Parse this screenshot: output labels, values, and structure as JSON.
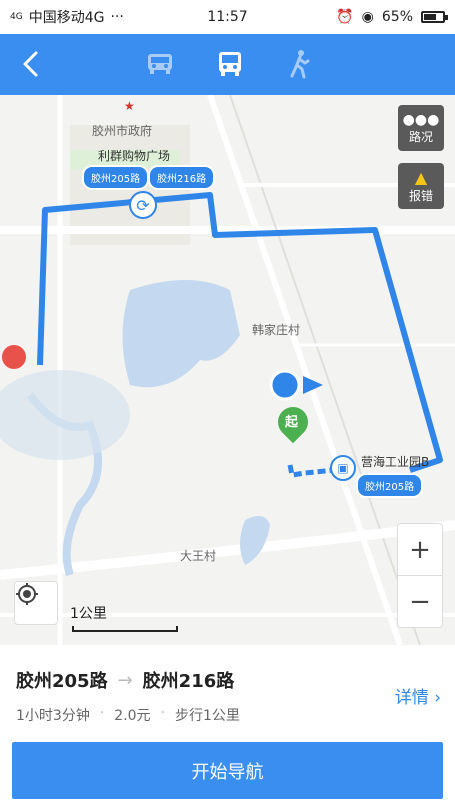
{
  "status": {
    "signal": "4G",
    "carrier": "中国移动4G",
    "time": "11:57",
    "battery_text": "65%",
    "battery_level": 0.65
  },
  "topbar": {
    "modes": [
      "car-icon",
      "bus-icon",
      "walk-icon"
    ],
    "active": "bus-icon"
  },
  "map": {
    "traffic_label": "路况",
    "report_label": "报错",
    "scale_label": "1公里",
    "pois": {
      "gov": "胶州市政府",
      "plaza": "利群购物广场",
      "village1": "韩家庄村",
      "village2": "大王村",
      "industry": "营海工业园B"
    },
    "bus_tags": {
      "tag1": "胶州205路",
      "tag2": "胶州216路",
      "tag3": "胶州205路"
    },
    "start_label": "起"
  },
  "panel": {
    "route_a": "胶州205路",
    "route_b": "胶州216路",
    "duration": "1小时3分钟",
    "price": "2.0元",
    "walk": "步行1公里",
    "detail_label": "详情",
    "nav_label": "开始导航"
  },
  "colors": {
    "accent": "#3a8ef0",
    "route": "#2f86e8",
    "start": "#4caf50"
  }
}
